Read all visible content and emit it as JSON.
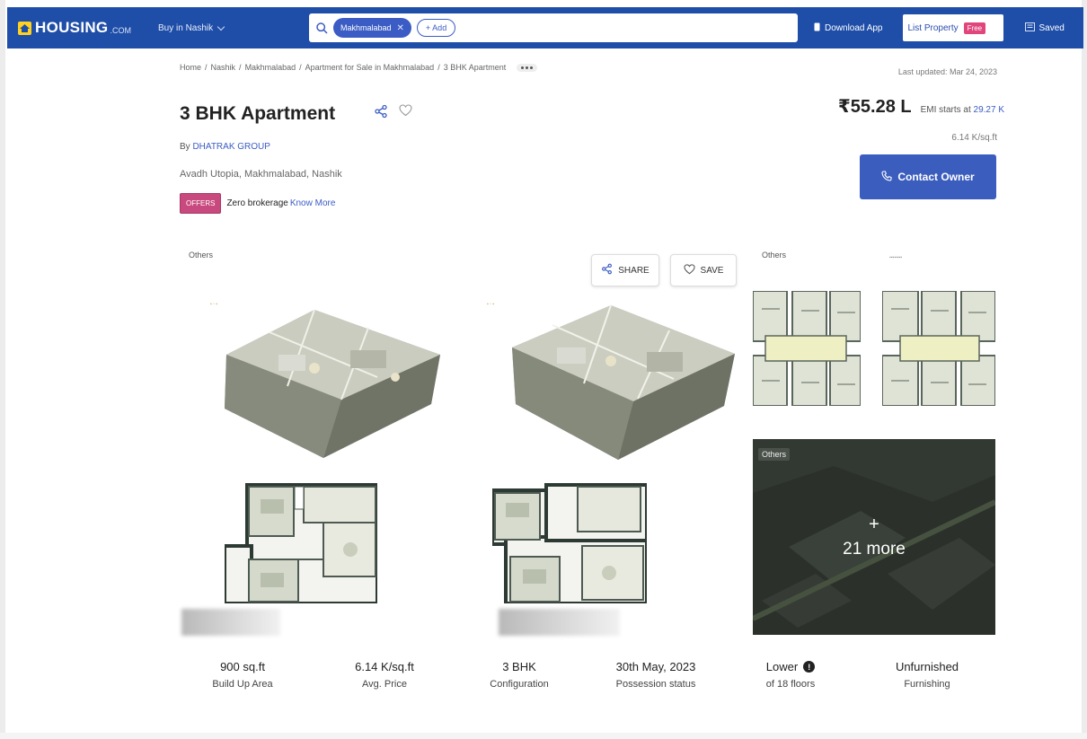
{
  "header": {
    "brand": "HOUSING",
    "brand_suffix": ".COM",
    "city_selector": "Buy in Nashik",
    "search_chip": "Makhmalabad",
    "add_label": "+ Add",
    "download_label": "Download App",
    "list_property_label": "List Property",
    "free_badge": "Free",
    "saved_label": "Saved"
  },
  "breadcrumb": {
    "items": [
      "Home",
      "Nashik",
      "Makhmalabad",
      "Apartment for Sale in Makhmalabad",
      "3 BHK Apartment"
    ],
    "separator": "/"
  },
  "last_updated": "Last updated: Mar 24, 2023",
  "listing": {
    "title": "3 BHK Apartment",
    "builder_prefix": "By",
    "builder": "DHATRAK GROUP",
    "location": "Avadh Utopia, Makhmalabad, Nashik",
    "offer_tag": "OFFERS",
    "offer_text": "Zero brokerage",
    "offer_link": "Know More",
    "price": "₹55.28 L",
    "emi_prefix": "EMI starts at",
    "emi_value": "29.27 K",
    "price_per_sqft": "6.14 K/sq.ft",
    "contact_label": "Contact Owner"
  },
  "gallery": {
    "label_left": "Others",
    "label_right": "Others",
    "share_label": "SHARE",
    "save_label": "SAVE",
    "more_tag": "Others",
    "more_plus": "+",
    "more_label": "21 more"
  },
  "stats": [
    {
      "value": "900 sq.ft",
      "label": "Build Up Area"
    },
    {
      "value": "6.14 K/sq.ft",
      "label": "Avg. Price"
    },
    {
      "value": "3 BHK",
      "label": "Configuration"
    },
    {
      "value": "30th May, 2023",
      "label": "Possession status"
    },
    {
      "value": "Lower",
      "label": "of 18 floors"
    },
    {
      "value": "Unfurnished",
      "label": "Furnishing"
    }
  ],
  "colors": {
    "nav_bg": "#1f4ea8",
    "accent": "#3b5cc4",
    "offer_tag": "#c8497d",
    "free_badge": "#e0457b",
    "logo_mark": "#ffd21f"
  }
}
